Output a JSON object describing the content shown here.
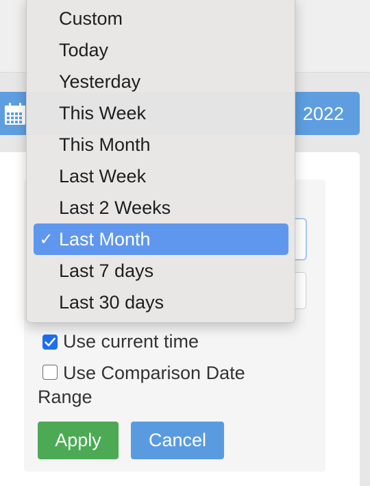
{
  "header": {
    "date_button_text": "2022"
  },
  "dropdown": {
    "items": [
      {
        "label": "Custom",
        "selected": false
      },
      {
        "label": "Today",
        "selected": false
      },
      {
        "label": "Yesterday",
        "selected": false
      },
      {
        "label": "This Week",
        "selected": false
      },
      {
        "label": "This Month",
        "selected": false
      },
      {
        "label": "Last Week",
        "selected": false
      },
      {
        "label": "Last 2 Weeks",
        "selected": false
      },
      {
        "label": "Last Month",
        "selected": true
      },
      {
        "label": "Last 7 days",
        "selected": false
      },
      {
        "label": "Last 30 days",
        "selected": false
      }
    ],
    "check_glyph": "✓"
  },
  "options": {
    "use_current_time": {
      "label": "Use current time",
      "checked": true
    },
    "use_comparison": {
      "label": "Use Comparison Date",
      "label_line2": "Range",
      "checked": false
    }
  },
  "buttons": {
    "apply": "Apply",
    "cancel": "Cancel"
  },
  "colors": {
    "primary_blue": "#5e9ee0",
    "apply_green": "#4caa54",
    "selection_blue": "#5f97ee",
    "checkbox_blue": "#1d6ff0"
  }
}
